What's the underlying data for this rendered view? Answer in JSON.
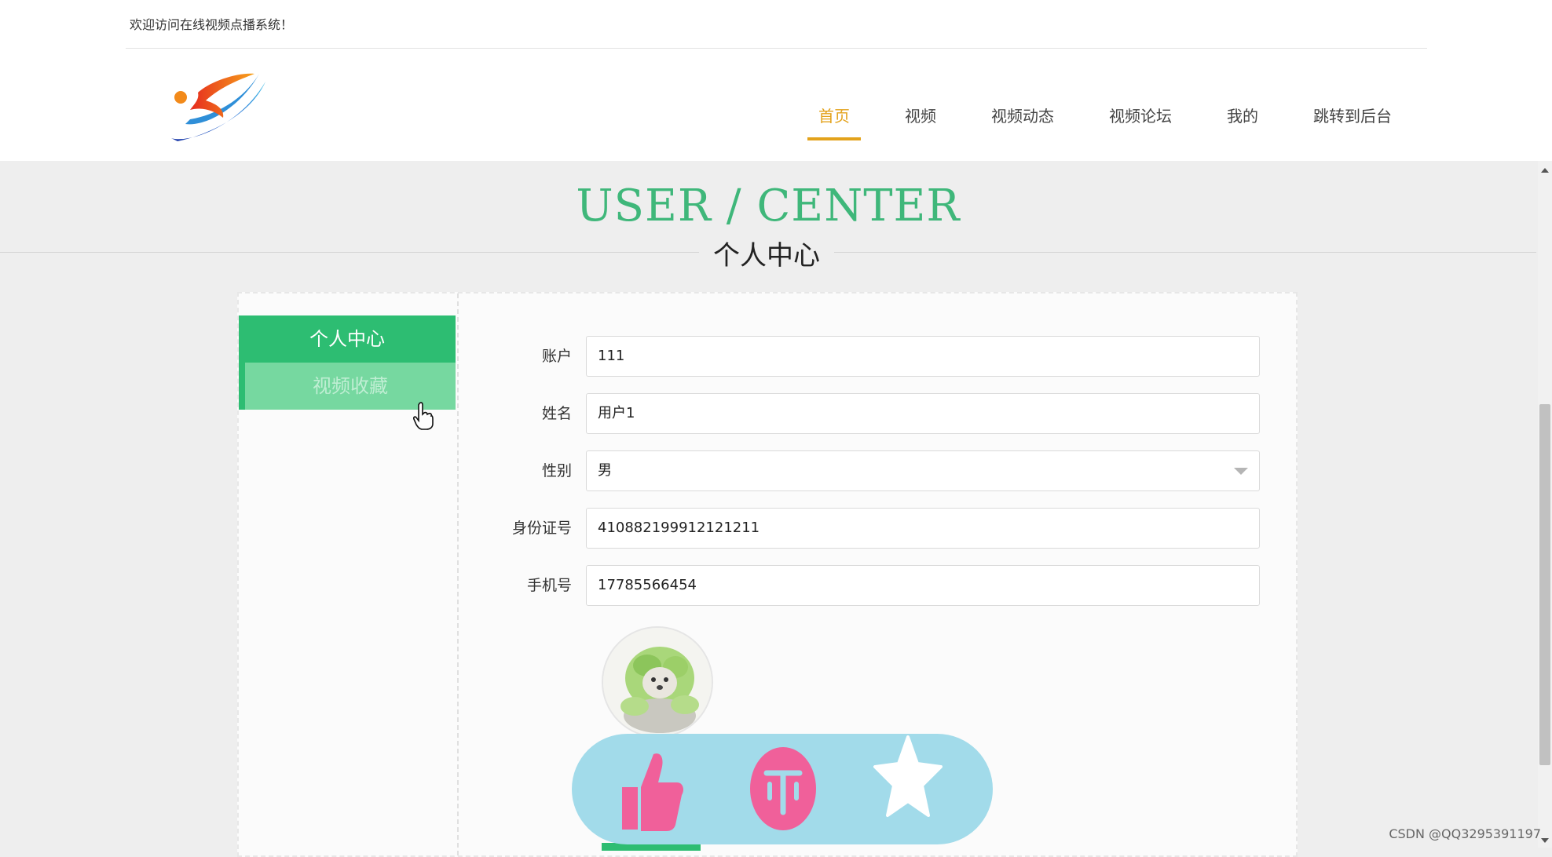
{
  "header": {
    "welcome": "欢迎访问在线视频点播系统！",
    "nav": [
      {
        "label": "首页",
        "active": true
      },
      {
        "label": "视频"
      },
      {
        "label": "视频动态"
      },
      {
        "label": "视频论坛"
      },
      {
        "label": "我的"
      },
      {
        "label": "跳转到后台"
      }
    ],
    "accent_color": "#e3a21b"
  },
  "hero": {
    "title": "USER / CENTER",
    "subtitle": "个人中心",
    "title_color": "#3fb77a"
  },
  "sidebar": {
    "items": [
      {
        "label": "个人中心",
        "state": "active"
      },
      {
        "label": "视频收藏",
        "state": "hover"
      }
    ],
    "active_color": "#2dbd72"
  },
  "form": {
    "fields": [
      {
        "label": "账户",
        "value": "111"
      },
      {
        "label": "姓名",
        "value": "用户1"
      },
      {
        "label": "性别",
        "value": "男"
      },
      {
        "label": "身份证号",
        "value": "410882199912121211"
      },
      {
        "label": "手机号",
        "value": "17785566454"
      }
    ]
  },
  "overlay": {
    "icons": [
      "thumbs-up-icon",
      "coin-icon",
      "star-icon"
    ],
    "background": "#a2dbea",
    "icon_color": "#f0609a"
  },
  "watermark": "CSDN @QQ3295391197"
}
